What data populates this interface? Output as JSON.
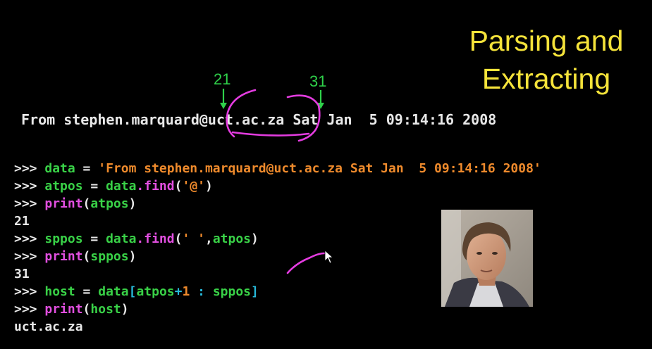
{
  "title_line1": "Parsing and",
  "title_line2": "Extracting",
  "marker_left": "21",
  "marker_right": "31",
  "from_line": "From stephen.marquard@uct.ac.za Sat Jan  5 09:14:16 2008",
  "code": {
    "prompt": ">>> ",
    "l1": {
      "var": "data",
      "eq": " = ",
      "str": "'From stephen.marquard@uct.ac.za Sat Jan  5 09:14:16 2008'"
    },
    "l2": {
      "var": "atpos",
      "eq": " = ",
      "obj": "data",
      "meth": ".find",
      "open": "(",
      "arg": "'@'",
      "close": ")"
    },
    "l3": {
      "fn": "print",
      "open": "(",
      "arg": "atpos",
      "close": ")"
    },
    "out1": "21",
    "l5": {
      "var": "sppos",
      "eq": " = ",
      "obj": "data",
      "meth": ".find",
      "open": "(",
      "arg": "' '",
      "comma": ",",
      "arg2": "atpos",
      "close": ")"
    },
    "l6": {
      "fn": "print",
      "open": "(",
      "arg": "sppos",
      "close": ")"
    },
    "out2": "31",
    "l8": {
      "var": "host",
      "eq": " = ",
      "obj": "data",
      "open": "[",
      "a": "atpos",
      "plus": "+",
      "one": "1",
      "colon": " : ",
      "b": "sppos",
      "close": "]"
    },
    "l9": {
      "fn": "print",
      "open": "(",
      "arg": "host",
      "close": ")"
    },
    "out3": "uct.ac.za"
  },
  "colors": {
    "title": "#f5e33a",
    "annotation": "#e43ce0",
    "marker": "#2fd14a"
  }
}
